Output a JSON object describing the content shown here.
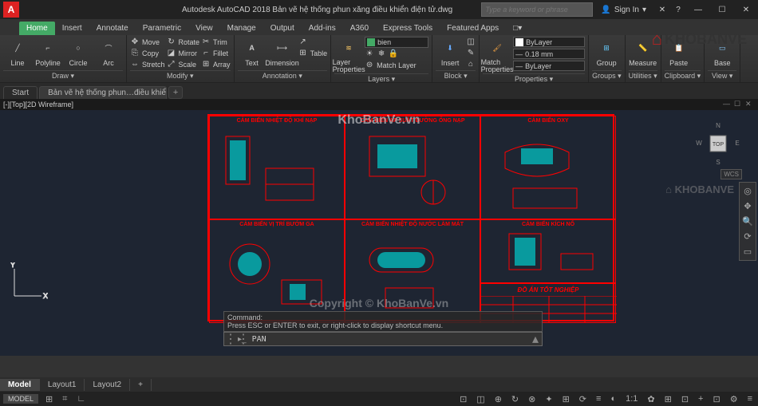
{
  "app": {
    "letter": "A",
    "title": "Autodesk AutoCAD 2018   Bản vẽ hệ thống phun xăng điều khiển điện tử.dwg",
    "search_placeholder": "Type a keyword or phrase",
    "signin": "Sign In"
  },
  "menu": {
    "tabs": [
      "Home",
      "Insert",
      "Annotate",
      "Parametric",
      "View",
      "Manage",
      "Output",
      "Add-ins",
      "A360",
      "Express Tools",
      "Featured Apps"
    ],
    "active": 0,
    "extra": "□▾"
  },
  "ribbon": {
    "draw": {
      "title": "Draw ▾",
      "line": "Line",
      "polyline": "Polyline",
      "circle": "Circle",
      "arc": "Arc"
    },
    "modify": {
      "title": "Modify ▾",
      "move": "Move",
      "copy": "Copy",
      "stretch": "Stretch",
      "rotate": "Rotate",
      "mirror": "Mirror",
      "scale": "Scale",
      "trim": "Trim",
      "fillet": "Fillet",
      "array": "Array"
    },
    "annotation": {
      "title": "Annotation ▾",
      "text": "Text",
      "dimension": "Dimension",
      "table": "Table"
    },
    "layers": {
      "title": "Layers ▾",
      "props": "Layer\nProperties",
      "current": "bien",
      "match": "Match Layer"
    },
    "block": {
      "title": "Block ▾",
      "insert": "Insert"
    },
    "properties": {
      "title": "Properties ▾",
      "match": "Match\nProperties",
      "color": "ByLayer",
      "lw": "0.18 mm",
      "lt": "ByLayer"
    },
    "groups": {
      "title": "Groups ▾",
      "group": "Group"
    },
    "utilities": {
      "title": "Utilities ▾",
      "measure": "Measure"
    },
    "clipboard": {
      "title": "Clipboard ▾",
      "paste": "Paste"
    },
    "view": {
      "title": "View ▾",
      "base": "Base"
    }
  },
  "docs": {
    "start": "Start",
    "file": "Bản vẽ hệ thống phun…điều khiển điện tử*"
  },
  "viewport": {
    "label": "[-][Top][2D Wireframe]"
  },
  "drawing": {
    "cells": [
      {
        "title": "CẢM BIẾN NHIỆT ĐỘ KHÍ NẠP"
      },
      {
        "title": "CẢM BIẾN ÁP SUẤT ĐƯỜNG ỐNG NẠP"
      },
      {
        "title": "CẢM BIẾN OXY"
      },
      {
        "title": "CẢM BIẾN VỊ TRÍ BƯỚM GA"
      },
      {
        "title": "CẢM BIẾN NHIỆT ĐỘ NƯỚC LÀM MÁT"
      },
      {
        "title": "CẢM BIẾN KÍCH NỔ"
      }
    ],
    "titleblock": "ĐỒ ÁN TỐT NGHIỆP"
  },
  "watermarks": {
    "top": "KhoBanVe.vn",
    "bottom": "Copyright © KhoBanVe.vn"
  },
  "logo": {
    "text": "KHOBANVE"
  },
  "nav": {
    "compass": [
      "N",
      "E",
      "S",
      "W"
    ],
    "cube": "TOP",
    "wcs": "WCS"
  },
  "cmd": {
    "hist1": "Command:",
    "hist2": "Press ESC or ENTER to exit, or right-click to display shortcut menu.",
    "prompt": "PAN",
    "icon": "▸_"
  },
  "layouts": {
    "tabs": [
      "Model",
      "Layout1",
      "Layout2"
    ],
    "add": "+"
  },
  "status": {
    "model": "MODEL",
    "icons": [
      "⊞",
      "⌗",
      "⊥",
      "∟",
      "⊡",
      "◫",
      "⊕",
      "↻",
      "⊗",
      "✦",
      "⊞",
      "⟳",
      "≡",
      "◐",
      "⊡",
      "1:1",
      "✿",
      "⊞",
      "⊡",
      "+",
      "⊡",
      "⚙",
      "≡"
    ]
  }
}
